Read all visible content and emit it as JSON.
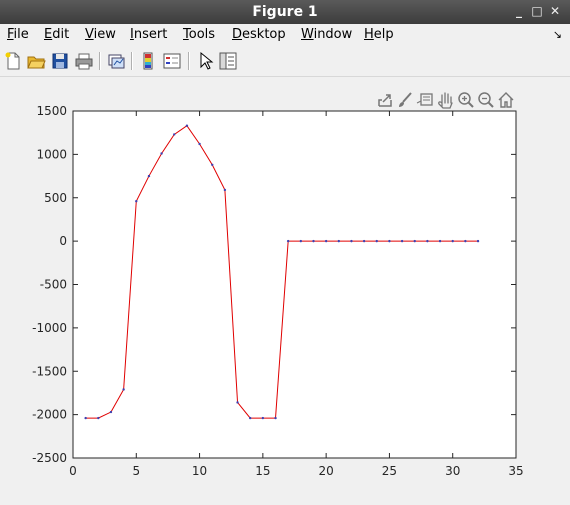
{
  "window": {
    "title": "Figure 1",
    "controls": [
      "_",
      "□",
      "✕"
    ]
  },
  "menubar": {
    "items": [
      {
        "label": "File",
        "mnemonic": "F",
        "rest": "ile"
      },
      {
        "label": "Edit",
        "mnemonic": "E",
        "rest": "dit"
      },
      {
        "label": "View",
        "mnemonic": "V",
        "rest": "iew"
      },
      {
        "label": "Insert",
        "mnemonic": "I",
        "rest": "nsert"
      },
      {
        "label": "Tools",
        "mnemonic": "T",
        "rest": "ools"
      },
      {
        "label": "Desktop",
        "mnemonic": "D",
        "rest": "esktop"
      },
      {
        "label": "Window",
        "mnemonic": "W",
        "rest": "indow"
      },
      {
        "label": "Help",
        "mnemonic": "H",
        "rest": "elp"
      }
    ],
    "dock_arrow": "↘"
  },
  "toolbar": {
    "buttons": [
      "new-figure-icon",
      "open-file-icon",
      "save-icon",
      "print-icon",
      "link-plot-icon",
      "insert-colorbar-icon",
      "insert-legend-icon",
      "edit-plot-icon",
      "property-inspector-icon"
    ]
  },
  "axes_toolbar": {
    "buttons": [
      "export-icon",
      "brush-icon",
      "datatip-icon",
      "pan-icon",
      "zoom-in-icon",
      "zoom-out-icon",
      "home-icon"
    ]
  },
  "chart_data": {
    "type": "line",
    "title": "",
    "xlabel": "",
    "ylabel": "",
    "xlim": [
      0,
      35
    ],
    "ylim": [
      -2500,
      1500
    ],
    "xticks": [
      0,
      5,
      10,
      15,
      20,
      25,
      30,
      35
    ],
    "yticks": [
      1500,
      1000,
      500,
      0,
      -500,
      -1000,
      -1500,
      -2000,
      -2500
    ],
    "grid": false,
    "line_color": "#e00000",
    "marker_color": "#4040b0",
    "series": [
      {
        "x": [
          1,
          2,
          3,
          4,
          5,
          6,
          7,
          8,
          9,
          10,
          11,
          12,
          13,
          14,
          15,
          16,
          17,
          18,
          19,
          20,
          21,
          22,
          23,
          24,
          25,
          26,
          27,
          28,
          29,
          30,
          31,
          32
        ],
        "y": [
          -2040,
          -2040,
          -1970,
          -1710,
          460,
          750,
          1010,
          1230,
          1330,
          1120,
          880,
          590,
          -1860,
          -2040,
          -2040,
          -2040,
          0,
          0,
          0,
          0,
          0,
          0,
          0,
          0,
          0,
          0,
          0,
          0,
          0,
          0,
          0,
          0
        ]
      }
    ]
  }
}
